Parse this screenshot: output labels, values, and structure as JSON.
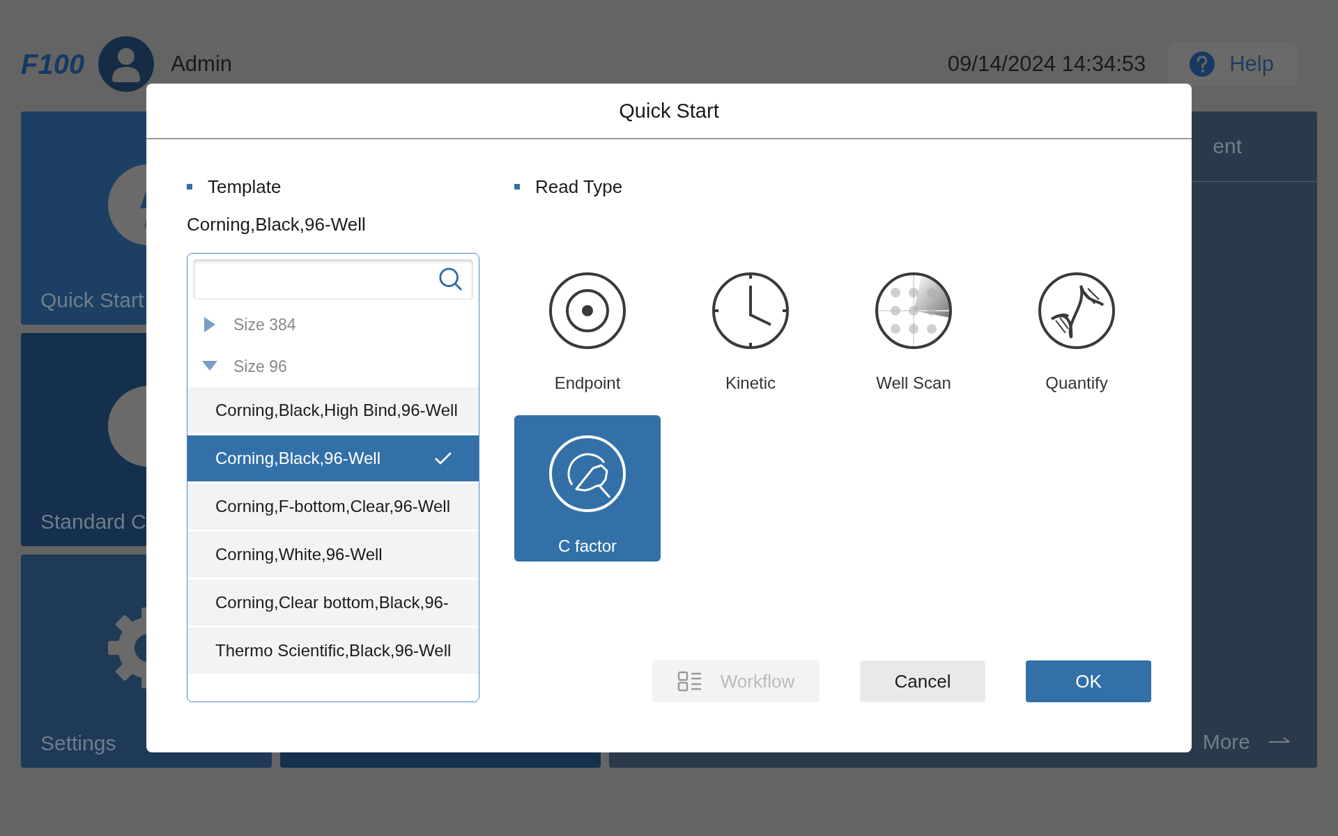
{
  "header": {
    "logo": "F100",
    "user": "Admin",
    "datetime": "09/14/2024 14:34:53",
    "help_button": "Help"
  },
  "background_tiles": [
    {
      "label": "Quick Start",
      "kind": "quick"
    },
    {
      "label": "Standard C",
      "kind": "standard"
    },
    {
      "label": "Settings",
      "kind": "settings"
    }
  ],
  "background_panel": {
    "title": "ent",
    "more_link": "More"
  },
  "dialog": {
    "title": "Quick Start",
    "template": {
      "heading": "Template",
      "current": "Corning,Black,96-Well",
      "groups": [
        {
          "label": "Size 384",
          "expanded": false
        },
        {
          "label": "Size 96",
          "expanded": true,
          "children": [
            {
              "label": "Corning,Black,High Bind,96-Well",
              "selected": false
            },
            {
              "label": "Corning,Black,96-Well",
              "selected": true
            },
            {
              "label": "Corning,F-bottom,Clear,96-Well",
              "selected": false
            },
            {
              "label": "Corning,White,96-Well",
              "selected": false
            },
            {
              "label": "Corning,Clear bottom,Black,96-",
              "selected": false
            },
            {
              "label": "Thermo Scientific,Black,96-Well",
              "selected": false
            }
          ]
        }
      ]
    },
    "read_type": {
      "heading": "Read Type",
      "options": [
        {
          "label": "Endpoint",
          "kind": "endpoint",
          "selected": false
        },
        {
          "label": "Kinetic",
          "kind": "kinetic",
          "selected": false
        },
        {
          "label": "Well Scan",
          "kind": "wellscan",
          "selected": false
        },
        {
          "label": "Quantify",
          "kind": "quantify",
          "selected": false
        },
        {
          "label": "C factor",
          "kind": "cfactor",
          "selected": true
        }
      ]
    },
    "buttons": [
      {
        "label": "Workflow",
        "kind": "workflow",
        "disabled": true
      },
      {
        "label": "Cancel",
        "kind": "secondary",
        "disabled": false
      },
      {
        "label": "OK",
        "kind": "primary",
        "disabled": false
      }
    ]
  }
}
